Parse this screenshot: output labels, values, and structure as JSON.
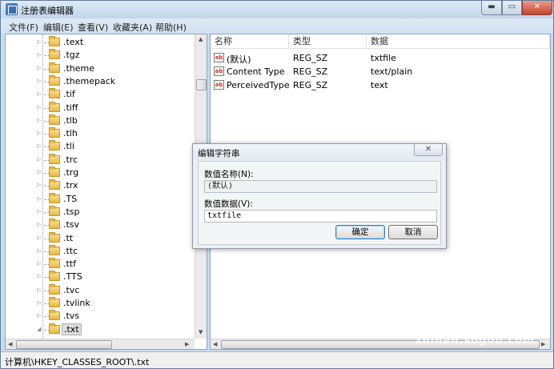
{
  "window": {
    "title": "注册表编辑器",
    "minimize_glyph": "▬",
    "maximize_glyph": "▭",
    "close_glyph": "✕"
  },
  "menu": {
    "items": [
      "文件(F)",
      "编辑(E)",
      "查看(V)",
      "收藏夹(A)",
      "帮助(H)"
    ]
  },
  "tree": {
    "items": [
      ".text",
      ".tgz",
      ".theme",
      ".themepack",
      ".tif",
      ".tiff",
      ".tlb",
      ".tlh",
      ".tli",
      ".trc",
      ".trg",
      ".trx",
      ".TS",
      ".tsp",
      ".tsv",
      ".tt",
      ".ttc",
      ".ttf",
      ".TTS",
      ".tvc",
      ".tvlink",
      ".tvs",
      ".txt"
    ],
    "selected_item": ".txt"
  },
  "list": {
    "headers": [
      "名称",
      "类型",
      "数据"
    ],
    "rows": [
      {
        "name": "(默认)",
        "type": "REG_SZ",
        "data": "txtfile",
        "icon": "reg-sz-icon"
      },
      {
        "name": "Content Type",
        "type": "REG_SZ",
        "data": "text/plain",
        "icon": "reg-sz-icon"
      },
      {
        "name": "PerceivedType",
        "type": "REG_SZ",
        "data": "text",
        "icon": "reg-sz-icon"
      }
    ]
  },
  "status": {
    "path": "计算机\\HKEY_CLASSES_ROOT\\.txt"
  },
  "dialog": {
    "title": "编辑字符串",
    "value_name_label": "数值名称(N):",
    "value_name": "(默认)",
    "value_data_label": "数值数据(V):",
    "value_data": "txtfile",
    "ok_label": "确定",
    "cancel_label": "取消"
  },
  "watermark": {
    "logo_letter": "S",
    "brand": "搜狗指南",
    "url": "zhinan.sogou.com"
  }
}
